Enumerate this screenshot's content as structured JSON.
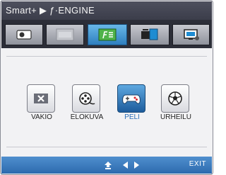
{
  "header": {
    "title": "Smart+ ▶ ƒ·ENGINE"
  },
  "tabs": [
    {
      "icon": "picture-icon",
      "active": false
    },
    {
      "icon": "auto-icon",
      "active": false
    },
    {
      "icon": "f-engine-icon",
      "active": true
    },
    {
      "icon": "split-screen-icon",
      "active": false
    },
    {
      "icon": "monitor-settings-icon",
      "active": false
    }
  ],
  "modes": [
    {
      "label": "VAKIO",
      "icon": "standard-icon",
      "selected": false
    },
    {
      "label": "ELOKUVA",
      "icon": "film-reel-icon",
      "selected": false
    },
    {
      "label": "PELI",
      "icon": "gamepad-icon",
      "selected": true
    },
    {
      "label": "URHEILU",
      "icon": "soccer-ball-icon",
      "selected": false
    }
  ],
  "footer": {
    "icons": [
      "up-arrow-icon",
      "left-arrow-icon",
      "right-arrow-icon"
    ],
    "exit_label": "EXIT"
  },
  "colors": {
    "title_bar": "#45475a",
    "tab_strip": "#2c2e38",
    "active_tab": "#3c8fd0",
    "selected_mode": "#2a6fb8",
    "footer": "#3a78ba"
  }
}
